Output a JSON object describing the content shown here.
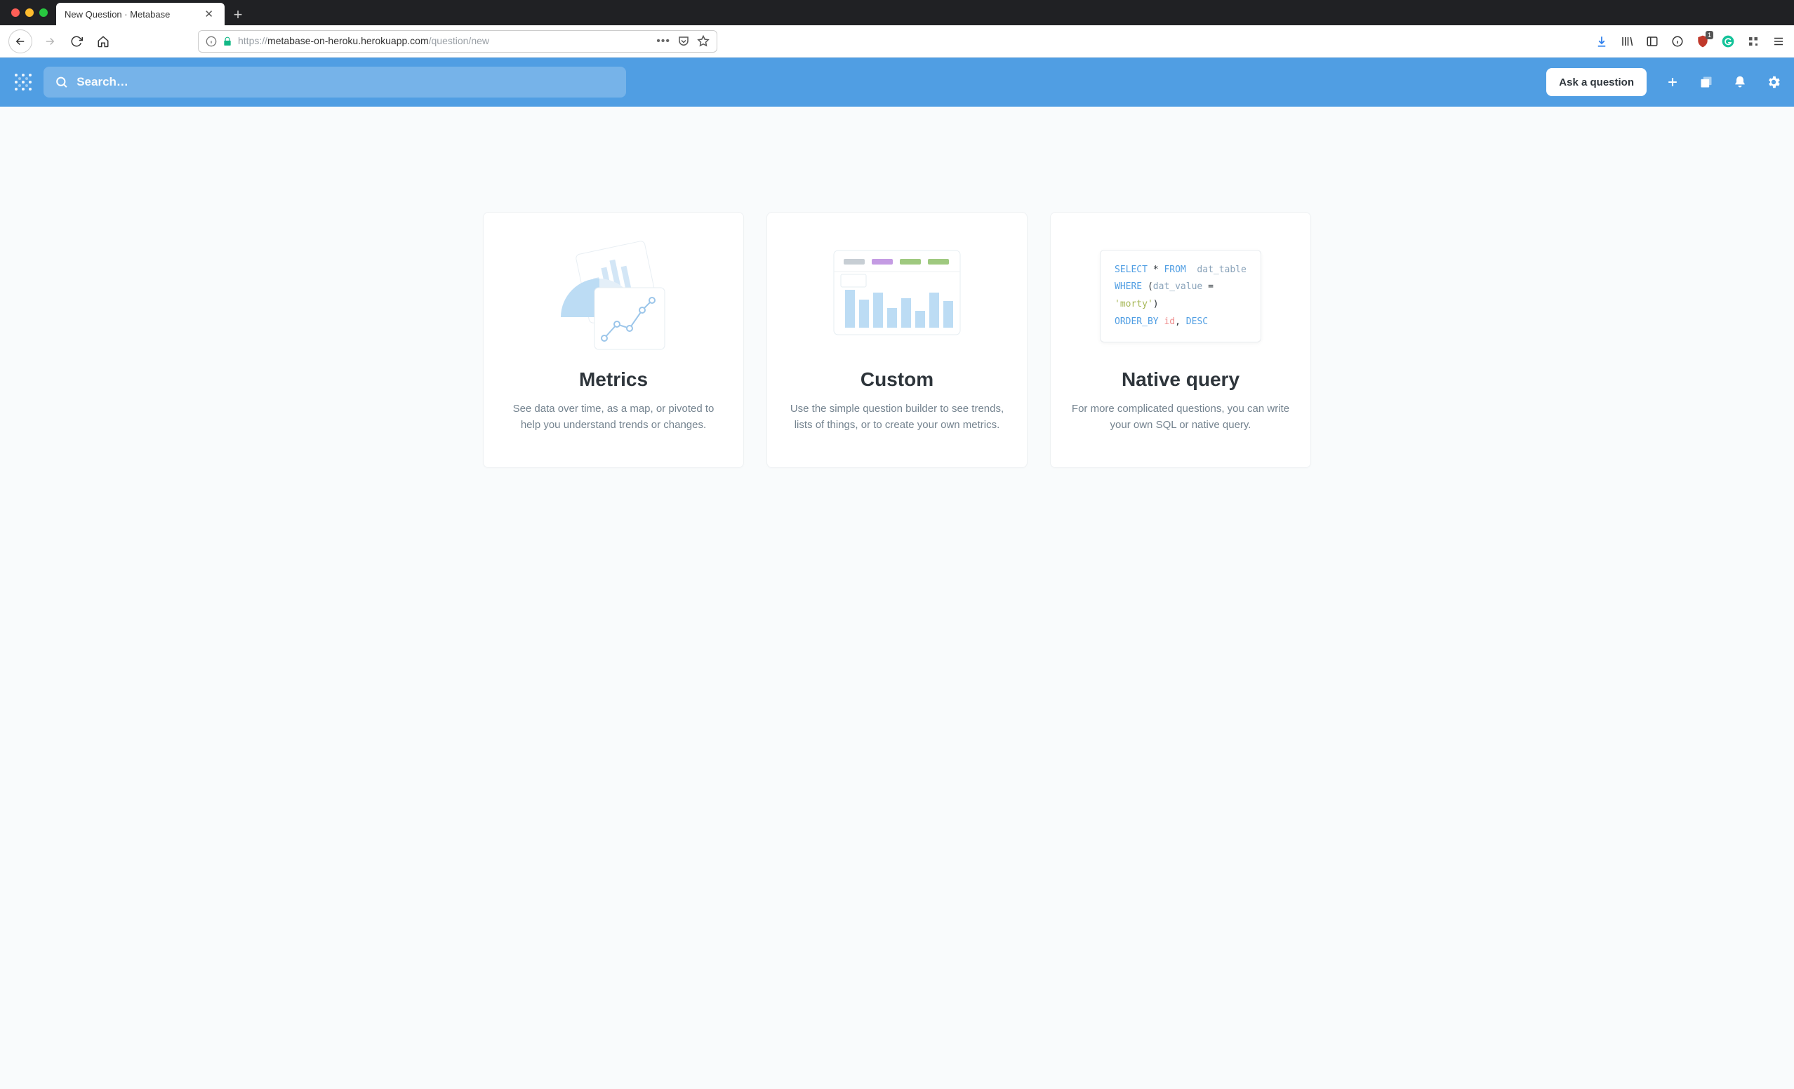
{
  "browser": {
    "tab_title": "New Question · Metabase",
    "url_protocol": "https://",
    "url_host": "metabase-on-heroku.herokuapp.com",
    "url_path": "/question/new",
    "ext_badge": "1"
  },
  "nav": {
    "search_placeholder": "Search…",
    "ask_button": "Ask a question"
  },
  "cards": [
    {
      "title": "Metrics",
      "desc": "See data over time, as a map, or pivoted to help you understand trends or changes."
    },
    {
      "title": "Custom",
      "desc": "Use the simple question builder to see trends, lists of things, or to create your own metrics."
    },
    {
      "title": "Native query",
      "desc": "For more complicated questions, you can write your own SQL or native query."
    }
  ],
  "sql_sample": {
    "l1_select": "SELECT",
    "l1_star": "*",
    "l1_from": "FROM",
    "l1_table": "dat_table",
    "l2_where": "WHERE",
    "l2_open": "(",
    "l2_col": "dat_value",
    "l2_eq": " = ",
    "l2_val": "'morty'",
    "l2_close": ")",
    "l3_order": "ORDER_BY",
    "l3_id": "id",
    "l3_comma": ",",
    "l3_desc": "DESC"
  }
}
